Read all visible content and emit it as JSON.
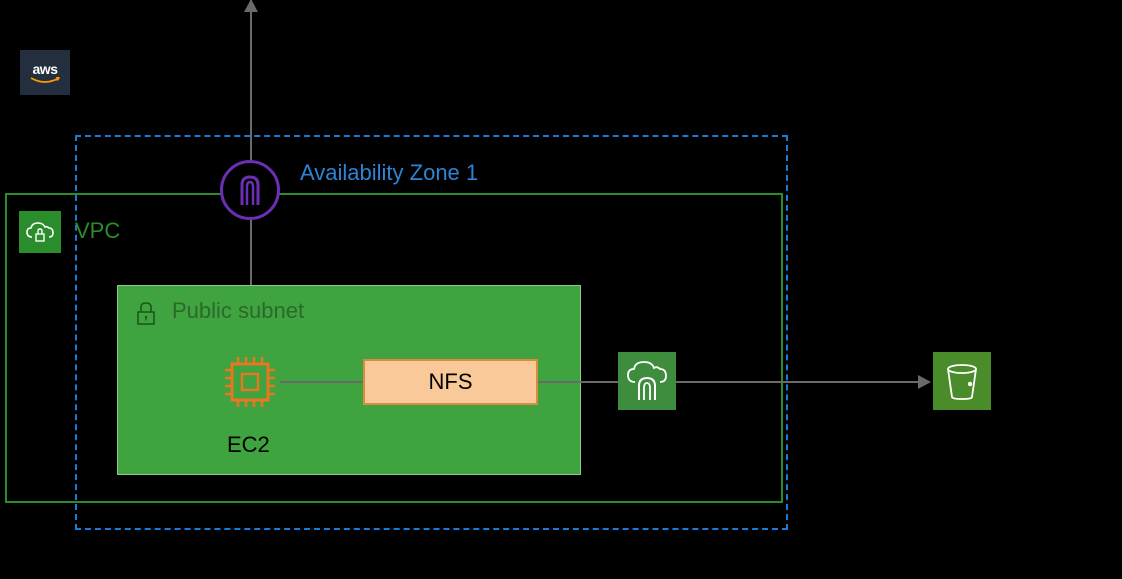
{
  "logo": {
    "text": "aws"
  },
  "availability_zone": {
    "label": "Availability Zone 1"
  },
  "vpc": {
    "label": "VPC"
  },
  "subnet": {
    "label": "Public subnet"
  },
  "compute": {
    "label": "EC2"
  },
  "storage_share": {
    "label": "NFS"
  },
  "icons": {
    "aws_logo": "aws-logo",
    "vpc_lock": "cloud-lock-icon",
    "internet_gateway": "gateway-icon",
    "subnet_lock": "lock-icon",
    "ec2": "chip-icon",
    "vpc_endpoint": "cloud-gateway-icon",
    "s3_bucket": "bucket-icon"
  },
  "colors": {
    "az_border": "#1a7ad4",
    "vpc_border": "#2a8c2a",
    "subnet_fill": "#3fa33f",
    "gateway_border": "#6b2fb3",
    "ec2_outline": "#e87722",
    "nfs_fill": "#f9c999",
    "endpoint_fill": "#3e8c3e",
    "s3_fill": "#4b8c2a"
  }
}
